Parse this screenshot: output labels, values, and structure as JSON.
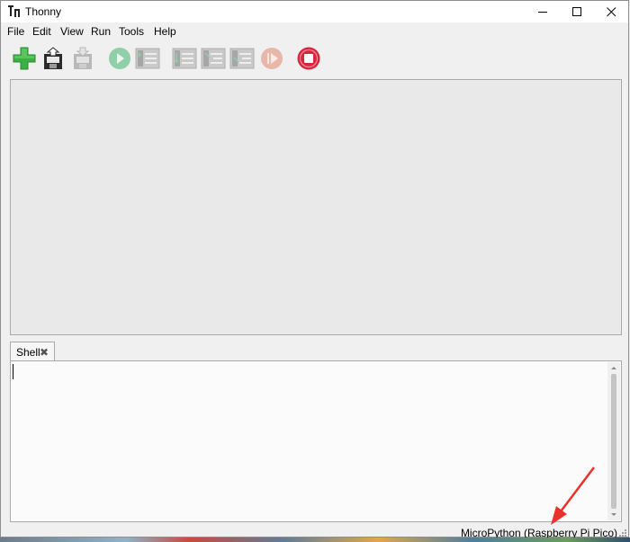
{
  "window": {
    "title": "Thonny"
  },
  "menu": {
    "items": [
      "File",
      "Edit",
      "View",
      "Run",
      "Tools",
      "Help"
    ]
  },
  "toolbar": {
    "buttons": [
      {
        "name": "new-file-button",
        "icon": "plus-icon",
        "enabled": true,
        "color": "#3cb043"
      },
      {
        "name": "open-file-button",
        "icon": "open-folder-icon",
        "enabled": true
      },
      {
        "name": "save-file-button",
        "icon": "save-icon",
        "enabled": false
      },
      {
        "name": "run-button",
        "icon": "play-icon",
        "enabled": false,
        "color": "#8fd0a8"
      },
      {
        "name": "debug-button",
        "icon": "debug-icon",
        "enabled": false
      },
      {
        "name": "step-over-button",
        "icon": "step-over-icon",
        "enabled": false
      },
      {
        "name": "step-into-button",
        "icon": "step-into-icon",
        "enabled": false
      },
      {
        "name": "step-out-button",
        "icon": "step-out-icon",
        "enabled": false
      },
      {
        "name": "resume-button",
        "icon": "resume-icon",
        "enabled": false,
        "color": "#e8b7a8"
      },
      {
        "name": "stop-button",
        "icon": "stop-icon",
        "enabled": true,
        "color": "#d9243b"
      }
    ]
  },
  "shell": {
    "tab_label": "Shell",
    "close_glyph": "✖"
  },
  "statusbar": {
    "interpreter": "MicroPython (Raspberry Pi Pico)"
  },
  "colors": {
    "annotation_arrow": "#e8322b"
  }
}
